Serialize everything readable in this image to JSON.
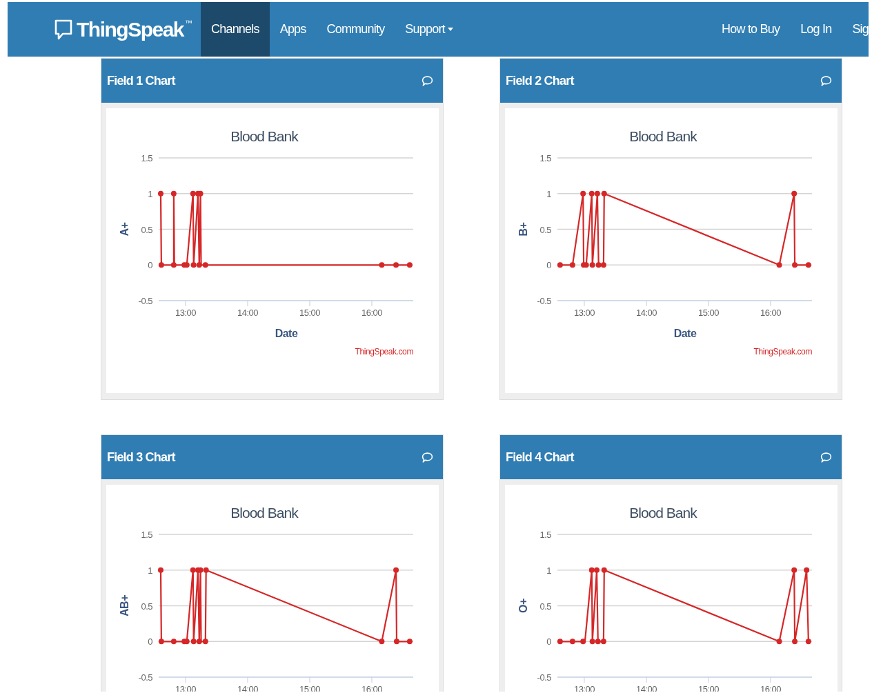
{
  "navbar": {
    "brand": "ThingSpeak",
    "trademark": "™",
    "items": [
      {
        "label": "Channels",
        "selected": true
      },
      {
        "label": "Apps",
        "selected": false
      },
      {
        "label": "Community",
        "selected": false
      },
      {
        "label": "Support",
        "selected": false,
        "dropdown": true
      }
    ],
    "right_items": [
      {
        "label": "How to Buy"
      },
      {
        "label": "Log In"
      },
      {
        "label": "Sig"
      }
    ]
  },
  "panels": [
    {
      "title": "Field 1 Chart",
      "credit": "ThingSpeak.com",
      "chart_data": {
        "type": "line",
        "grid": true,
        "title": "Blood Bank",
        "xlabel": "Date",
        "ylabel": "A+",
        "xlim": [
          12.567,
          16.667
        ],
        "ylim": [
          -0.5,
          1.5
        ],
        "yticks": [
          -0.5,
          0,
          0.5,
          1,
          1.5
        ],
        "xticks": [
          {
            "value": 13,
            "label": "13:00"
          },
          {
            "value": 14,
            "label": "14:00"
          },
          {
            "value": 15,
            "label": "15:00"
          },
          {
            "value": 16,
            "label": "16:00"
          }
        ],
        "x": [
          12.6,
          12.61,
          12.81,
          12.81,
          12.82,
          12.98,
          13.02,
          13.12,
          13.13,
          13.2,
          13.22,
          13.24,
          13.25,
          13.32,
          16.16,
          16.39,
          16.61
        ],
        "series": [
          {
            "color": "#d62728",
            "marker": true,
            "values": [
              1,
              0,
              0,
              1,
              0,
              0,
              0,
              1,
              0,
              1,
              0,
              1,
              0,
              0,
              0,
              0,
              0
            ]
          }
        ]
      }
    },
    {
      "title": "Field 2 Chart",
      "credit": "ThingSpeak.com",
      "chart_data": {
        "type": "line",
        "grid": true,
        "title": "Blood Bank",
        "xlabel": "Date",
        "ylabel": "B+",
        "xlim": [
          12.567,
          16.667
        ],
        "ylim": [
          -0.5,
          1.5
        ],
        "yticks": [
          -0.5,
          0,
          0.5,
          1,
          1.5
        ],
        "xticks": [
          {
            "value": 13,
            "label": "13:00"
          },
          {
            "value": 14,
            "label": "14:00"
          },
          {
            "value": 15,
            "label": "15:00"
          },
          {
            "value": 16,
            "label": "16:00"
          }
        ],
        "x": [
          12.61,
          12.81,
          12.98,
          12.99,
          13.03,
          13.12,
          13.13,
          13.21,
          13.23,
          13.31,
          13.32,
          16.14,
          16.38,
          16.39,
          16.61
        ],
        "series": [
          {
            "color": "#d62728",
            "marker": true,
            "values": [
              0,
              0,
              1,
              0,
              0,
              1,
              0,
              1,
              0,
              0,
              1,
              0,
              1,
              0,
              0
            ]
          }
        ]
      }
    },
    {
      "title": "Field 3 Chart",
      "chart_data": {
        "type": "line",
        "grid": true,
        "title": "Blood Bank",
        "ylabel": "AB+",
        "xlim": [
          12.567,
          16.667
        ],
        "ylim": [
          -0.5,
          1.5
        ],
        "yticks": [
          -0.5,
          0,
          0.5,
          1,
          1.5
        ],
        "xticks": [
          {
            "value": 13,
            "label": "13:00"
          },
          {
            "value": 14,
            "label": "14:00"
          },
          {
            "value": 15,
            "label": "15:00"
          },
          {
            "value": 16,
            "label": "16:00"
          }
        ],
        "x": [
          12.6,
          12.61,
          12.81,
          12.98,
          13.02,
          13.12,
          13.13,
          13.2,
          13.22,
          13.24,
          13.25,
          13.32,
          13.33,
          16.16,
          16.39,
          16.4,
          16.61
        ],
        "series": [
          {
            "color": "#d62728",
            "marker": true,
            "values": [
              1,
              0,
              0,
              0,
              0,
              1,
              0,
              1,
              0,
              1,
              0,
              0,
              1,
              0,
              1,
              0,
              0
            ]
          }
        ]
      }
    },
    {
      "title": "Field 4 Chart",
      "chart_data": {
        "type": "line",
        "grid": true,
        "title": "Blood Bank",
        "ylabel": "O+",
        "xlim": [
          12.567,
          16.667
        ],
        "ylim": [
          -0.5,
          1.5
        ],
        "yticks": [
          -0.5,
          0,
          0.5,
          1,
          1.5
        ],
        "xticks": [
          {
            "value": 13,
            "label": "13:00"
          },
          {
            "value": 14,
            "label": "14:00"
          },
          {
            "value": 15,
            "label": "15:00"
          },
          {
            "value": 16,
            "label": "16:00"
          }
        ],
        "x": [
          12.61,
          12.81,
          12.98,
          13.01,
          13.12,
          13.13,
          13.2,
          13.22,
          13.31,
          13.32,
          16.14,
          16.38,
          16.39,
          16.58,
          16.61
        ],
        "series": [
          {
            "color": "#d62728",
            "marker": true,
            "values": [
              0,
              0,
              0,
              0,
              1,
              0,
              1,
              0,
              0,
              1,
              0,
              1,
              0,
              1,
              0
            ]
          }
        ]
      }
    }
  ]
}
